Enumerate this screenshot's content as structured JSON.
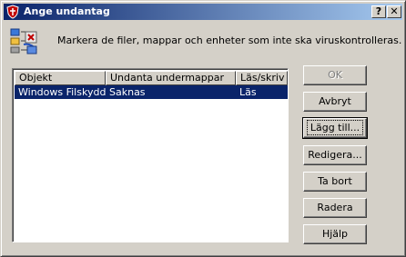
{
  "window": {
    "title": "Ange undantag",
    "help_label": "?",
    "close_label": "✕"
  },
  "instruction": "Markera de filer, mappar och enheter som inte ska viruskontrolleras.",
  "list": {
    "columns": [
      "Objekt",
      "Undanta undermappar",
      "Läs/skriv"
    ],
    "rows": [
      {
        "object": "Windows Filskydd",
        "subfolders": "Saknas",
        "access": "Läs",
        "selected": true
      }
    ]
  },
  "buttons": {
    "ok": "OK",
    "cancel": "Avbryt",
    "add": "Lägg till...",
    "edit": "Redigera...",
    "remove": "Ta bort",
    "clear": "Radera",
    "help": "Hjälp"
  },
  "colors": {
    "title_start": "#0a246a",
    "title_end": "#a6caf0",
    "selection": "#0a246a",
    "face": "#d4d0c8"
  }
}
